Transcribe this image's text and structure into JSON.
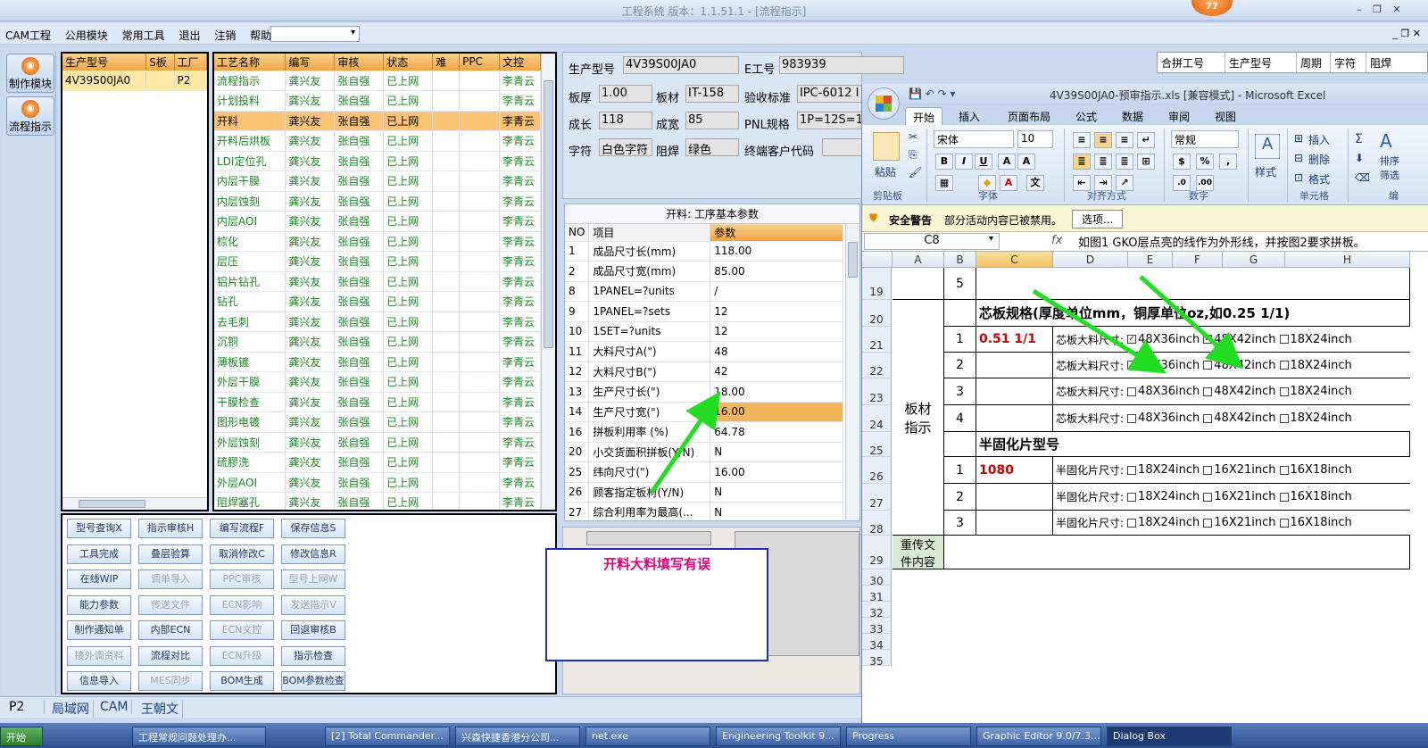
{
  "window": {
    "title": "工程系统  版本：1.1.51.1 - [流程指示]",
    "badge": "77"
  },
  "menu": [
    "CAM工程",
    "公用模块",
    "常用工具",
    "退出",
    "注销",
    "帮助"
  ],
  "nav": [
    {
      "label": "制作模块"
    },
    {
      "label": "流程指示"
    }
  ],
  "product_table": {
    "headers": [
      "生产型号",
      "S板",
      "工厂"
    ],
    "rows": [
      [
        "4V39S00JA0",
        "",
        "P2"
      ]
    ]
  },
  "process_table": {
    "headers": [
      "工艺名称",
      "编写",
      "审核",
      "状态",
      "难",
      "PPC",
      "文控"
    ],
    "rows": [
      [
        "流程指示",
        "龚兴友",
        "张自强",
        "已上网",
        "",
        "",
        "李青云"
      ],
      [
        "计划投料",
        "龚兴友",
        "张自强",
        "已上网",
        "",
        "",
        "李青云"
      ],
      [
        "开料",
        "龚兴友",
        "张自强",
        "已上网",
        "",
        "",
        "李青云"
      ],
      [
        "开料后烘板",
        "龚兴友",
        "张自强",
        "已上网",
        "",
        "",
        "李青云"
      ],
      [
        "LDI定位孔",
        "龚兴友",
        "张自强",
        "已上网",
        "",
        "",
        "李青云"
      ],
      [
        "内层干膜",
        "龚兴友",
        "张自强",
        "已上网",
        "",
        "",
        "李青云"
      ],
      [
        "内层蚀刻",
        "龚兴友",
        "张自强",
        "已上网",
        "",
        "",
        "李青云"
      ],
      [
        "内层AOI",
        "龚兴友",
        "张自强",
        "已上网",
        "",
        "",
        "李青云"
      ],
      [
        "棕化",
        "龚兴友",
        "张自强",
        "已上网",
        "",
        "",
        "李青云"
      ],
      [
        "层压",
        "龚兴友",
        "张自强",
        "已上网",
        "",
        "",
        "李青云"
      ],
      [
        "铝片钻孔",
        "龚兴友",
        "张自强",
        "已上网",
        "",
        "",
        "李青云"
      ],
      [
        "钻孔",
        "龚兴友",
        "张自强",
        "已上网",
        "",
        "",
        "李青云"
      ],
      [
        "去毛刺",
        "龚兴友",
        "张自强",
        "已上网",
        "",
        "",
        "李青云"
      ],
      [
        "沉铜",
        "龚兴友",
        "张自强",
        "已上网",
        "",
        "",
        "李青云"
      ],
      [
        "薄板镀",
        "龚兴友",
        "张自强",
        "已上网",
        "",
        "",
        "李青云"
      ],
      [
        "外层干膜",
        "龚兴友",
        "张自强",
        "已上网",
        "",
        "",
        "李青云"
      ],
      [
        "干膜检查",
        "龚兴友",
        "张自强",
        "已上网",
        "",
        "",
        "李青云"
      ],
      [
        "图形电镀",
        "龚兴友",
        "张自强",
        "已上网",
        "",
        "",
        "李青云"
      ],
      [
        "外层蚀刻",
        "龚兴友",
        "张自强",
        "已上网",
        "",
        "",
        "李青云"
      ],
      [
        "硫膠洗",
        "龚兴友",
        "张自强",
        "已上网",
        "",
        "",
        "李青云"
      ],
      [
        "外层AOI",
        "龚兴友",
        "张自强",
        "已上网",
        "",
        "",
        "李青云"
      ],
      [
        "阻焊塞孔",
        "龚兴友",
        "张自强",
        "已上网",
        "",
        "",
        "李青云"
      ]
    ]
  },
  "buttons": [
    [
      "型号查询X",
      "指示审核H",
      "编写流程F",
      "保存信息S"
    ],
    [
      "工具完成",
      "叠层验算",
      "取消修改C",
      "修改信息R"
    ],
    [
      "在线WIP",
      "调单导入",
      "PPC审核",
      "型号上网W"
    ],
    [
      "能力参数",
      "传送文件",
      "ECN影响",
      "发送指示V"
    ],
    [
      "制作通知单",
      "内部ECN",
      "ECN文控",
      "回退审核B"
    ],
    [
      "接外调资料",
      "流程对比",
      "ECN升级",
      "指示检查"
    ],
    [
      "信息导入",
      "MES同步",
      "BOM生成",
      "BOM参数检查"
    ]
  ],
  "disabled_buttons": [
    "调单导入",
    "PPC审核",
    "型号上网W",
    "传送文件",
    "ECN影响",
    "发送指示V",
    "ECN文控",
    "接外调资料",
    "ECN升级",
    "MES同步"
  ],
  "info": {
    "生产型号": "4V39S00JA0",
    "E工号": "983939",
    "板厚": "1.00",
    "板材": "IT-158",
    "验收标准": "IPC-6012 I",
    "成长": "118",
    "成宽": "85",
    "PNL规格": "1P=12S=1",
    "字符": "白色字符",
    "阻焊": "绿色",
    "终端客户代码": ""
  },
  "info_labels": {
    "l1": "生产型号",
    "l2": "E工号",
    "l3": "板厚",
    "l4": "板材",
    "l5": "验收标准",
    "l6": "成长",
    "l7": "成宽",
    "l8": "PNL规格",
    "l9": "字符",
    "l10": "阻焊",
    "l11": "终端客户代码"
  },
  "param_panel": {
    "title": "开料: 工序基本参数",
    "headers": [
      "NO",
      "项目",
      "参数"
    ],
    "rows": [
      [
        "1",
        "成品尺寸长(mm)",
        "118.00"
      ],
      [
        "2",
        "成品尺寸宽(mm)",
        "85.00"
      ],
      [
        "8",
        "1PANEL=?units",
        "/"
      ],
      [
        "9",
        "1PANEL=?sets",
        "12"
      ],
      [
        "10",
        "1SET=?units",
        "12"
      ],
      [
        "11",
        "大料尺寸A(\")",
        "48"
      ],
      [
        "12",
        "大料尺寸B(\")",
        "42"
      ],
      [
        "13",
        "生产尺寸长(\")",
        "18.00"
      ],
      [
        "14",
        "生产尺寸宽(\")",
        "16.00"
      ],
      [
        "16",
        "拼板利用率 (%)",
        "64.78"
      ],
      [
        "20",
        "小交货面积拼板(Y/N)",
        "N"
      ],
      [
        "25",
        "纬向尺寸(\")",
        "16.00"
      ],
      [
        "26",
        "顾客指定板材(Y/N)",
        "N"
      ],
      [
        "27",
        "综合利用率为最高(...",
        "N"
      ]
    ]
  },
  "error_note": "开料大料填写有误",
  "right_headers": [
    "合拼工号",
    "生产型号",
    "周期",
    "字符",
    "阻焊"
  ],
  "excel": {
    "title": "4V39S00JA0-预审指示.xls  [兼容模式] - Microsoft Excel",
    "tabs": [
      "开始",
      "插入",
      "页面布局",
      "公式",
      "数据",
      "审阅",
      "视图"
    ],
    "font": "宋体",
    "size": "10",
    "numfmt": "常规",
    "groups": [
      "剪贴板",
      "字体",
      "对齐方式",
      "数字",
      "单元格",
      "编"
    ],
    "ribbon_labels": {
      "paste": "粘贴",
      "style": "样式",
      "insert": "插入",
      "delete": "删除",
      "format": "格式",
      "sort": "排序",
      "filter": "筛选"
    },
    "security": {
      "title": "安全警告",
      "msg": "部分活动内容已被禁用。",
      "btn": "选项..."
    },
    "namebox": "C8",
    "fx": "如图1 GKO层点亮的线作为外形线，并按图2要求拼板。",
    "cols": [
      "A",
      "B",
      "C",
      "D",
      "E",
      "F",
      "G",
      "H"
    ],
    "row_nums": [
      "19",
      "20",
      "21",
      "22",
      "23",
      "24",
      "25",
      "26",
      "27",
      "28",
      "29",
      "30",
      "31",
      "32",
      "33",
      "34",
      "35"
    ],
    "r19": "5",
    "core_title": "芯板规格(厚度单位mm，铜厚单位oz,如0.25 1/1)",
    "core_rows": [
      {
        "n": "1",
        "val": "0.51 1/1",
        "lbl": "芯板大料尺寸:",
        "o": [
          "48X36inch",
          "48X42inch",
          "18X24inch"
        ]
      },
      {
        "n": "2",
        "val": "",
        "lbl": "芯板大料尺寸:",
        "o": [
          "48X36inch",
          "48X42inch",
          "18X24inch"
        ]
      },
      {
        "n": "3",
        "val": "",
        "lbl": "芯板大料尺寸:",
        "o": [
          "48X36inch",
          "48X42inch",
          "18X24inch"
        ]
      },
      {
        "n": "4",
        "val": "",
        "lbl": "芯板大料尺寸:",
        "o": [
          "48X36inch",
          "48X42inch",
          "18X24inch"
        ]
      }
    ],
    "board_label": "板材\n指示",
    "pp_title": "半固化片型号",
    "pp_rows": [
      {
        "n": "1",
        "val": "1080",
        "lbl": "半固化片尺寸:",
        "o": [
          "18X24inch",
          "16X21inch",
          "16X18inch"
        ]
      },
      {
        "n": "2",
        "val": "",
        "lbl": "半固化片尺寸:",
        "o": [
          "18X24inch",
          "16X21inch",
          "16X18inch"
        ]
      },
      {
        "n": "3",
        "val": "",
        "lbl": "半固化片尺寸:",
        "o": [
          "18X24inch",
          "16X21inch",
          "16X18inch"
        ]
      }
    ],
    "resend": "重传文\n件内容"
  },
  "status_tabs": [
    "P2",
    "局域网",
    "CAM",
    "王朝文"
  ],
  "taskbar": [
    "开始",
    "工程常规问题处理办...",
    "[2] Total Commander...",
    "兴森快捷香港分公司...",
    "net.exe",
    "Engineering Toolkit 9...",
    "Progress",
    "Graphic Editor 9.0/7.3...",
    "Dialog Box"
  ]
}
